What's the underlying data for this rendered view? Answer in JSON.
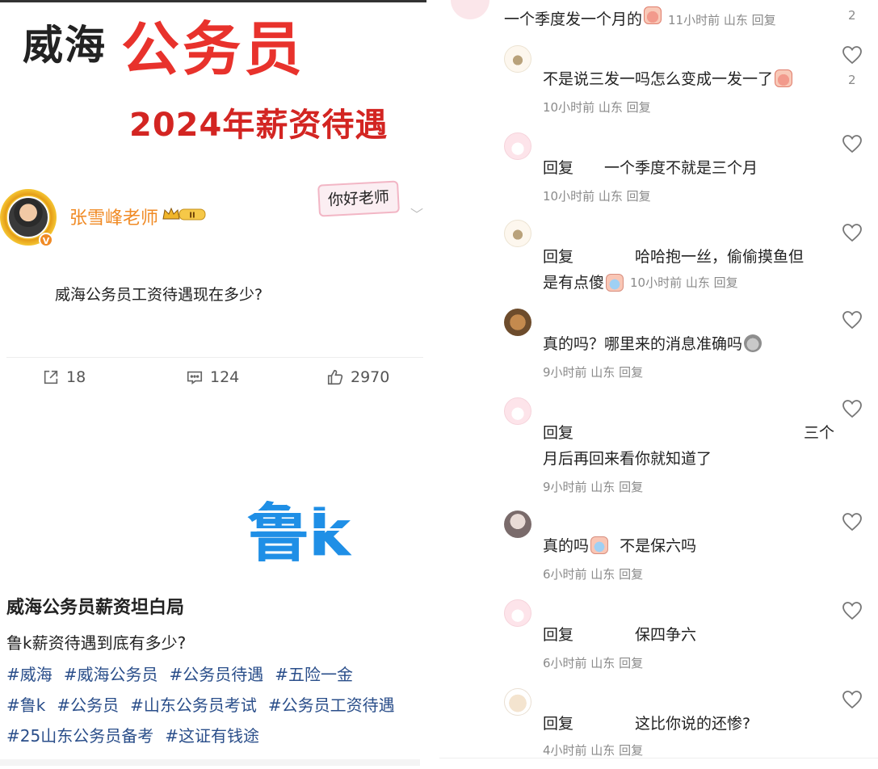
{
  "left": {
    "hero": {
      "city": "威海",
      "title": "公务员",
      "subtitle": "2024年薪资待遇"
    },
    "author": {
      "name": "张雪峰老师",
      "level_badge": "II",
      "sticker": "你好老师",
      "verified": "V"
    },
    "post_text": "威海公务员工资待遇现在多少?",
    "stats": {
      "shares": "18",
      "comments": "124",
      "likes": "2970"
    },
    "logo_text": "鲁k",
    "article": {
      "title": "威海公务员薪资坦白局",
      "body": "鲁k薪资待遇到底有多少?",
      "tags": [
        "#威海",
        "#威海公务员",
        "#公务员待遇",
        "#五险一金",
        "#鲁k",
        "#公务员",
        "#山东公务员考试",
        "#公务员工资待遇",
        "#25山东公务员备考",
        "#这证有钱途"
      ]
    }
  },
  "right": {
    "top_comment": {
      "text": "一个季度发一个月的",
      "meta": "11小时前 山东 回复",
      "count": "2"
    },
    "comments": [
      {
        "text": "不是说三发一吗怎么变成一发一了",
        "meta": "10小时前 山东 回复",
        "count": "2"
      },
      {
        "text": "回复　　一个季度不就是三个月",
        "meta": "10小时前 山东 回复",
        "count": ""
      },
      {
        "text_line1": "回复　　　　哈哈抱一丝，偷偷摸鱼但",
        "text_line2": "是有点傻",
        "meta": "10小时前 山东 回复",
        "count": ""
      },
      {
        "text": "真的吗？哪里来的消息准确吗",
        "meta": "9小时前 山东 回复",
        "count": ""
      },
      {
        "text_line1": "回复　　　　　　　　　　　　　　　三个",
        "text_line2": "月后再回来看你就知道了",
        "meta": "9小时前 山东 回复",
        "count": ""
      },
      {
        "text": "真的吗",
        "text_after": "不是保六吗",
        "meta": "6小时前 山东 回复",
        "count": ""
      },
      {
        "text": "回复　　　　保四争六",
        "meta": "6小时前 山东 回复",
        "count": ""
      },
      {
        "text": "回复　　　　这比你说的还惨?",
        "meta": "4小时前 山东 回复",
        "count": ""
      }
    ]
  }
}
